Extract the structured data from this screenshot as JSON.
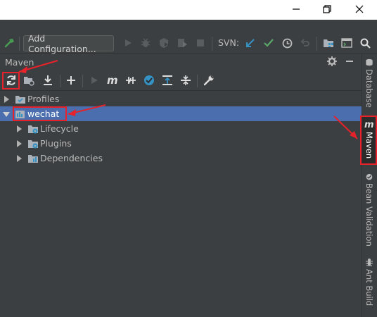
{
  "toolbar": {
    "run_config_label": "Add Configuration...",
    "svn_label": "SVN:"
  },
  "maven_panel": {
    "title": "Maven",
    "tree": [
      {
        "label": "Profiles",
        "level": 0,
        "expanded": false
      },
      {
        "label": "wechat",
        "level": 0,
        "expanded": true,
        "selected": true
      },
      {
        "label": "Lifecycle",
        "level": 1,
        "expanded": false
      },
      {
        "label": "Plugins",
        "level": 1,
        "expanded": false
      },
      {
        "label": "Dependencies",
        "level": 1,
        "expanded": false
      }
    ]
  },
  "right_strip": {
    "tabs": [
      {
        "label": "Database"
      },
      {
        "label": "Maven",
        "active": true
      },
      {
        "label": "Bean Validation"
      },
      {
        "label": "Ant Build"
      }
    ]
  },
  "colors": {
    "background": "#3c3f41",
    "selection": "#4b6eaf",
    "annotation": "#e8222a",
    "svn_update": "#3592c4",
    "svn_commit": "#59a869",
    "build": "#499c54"
  }
}
